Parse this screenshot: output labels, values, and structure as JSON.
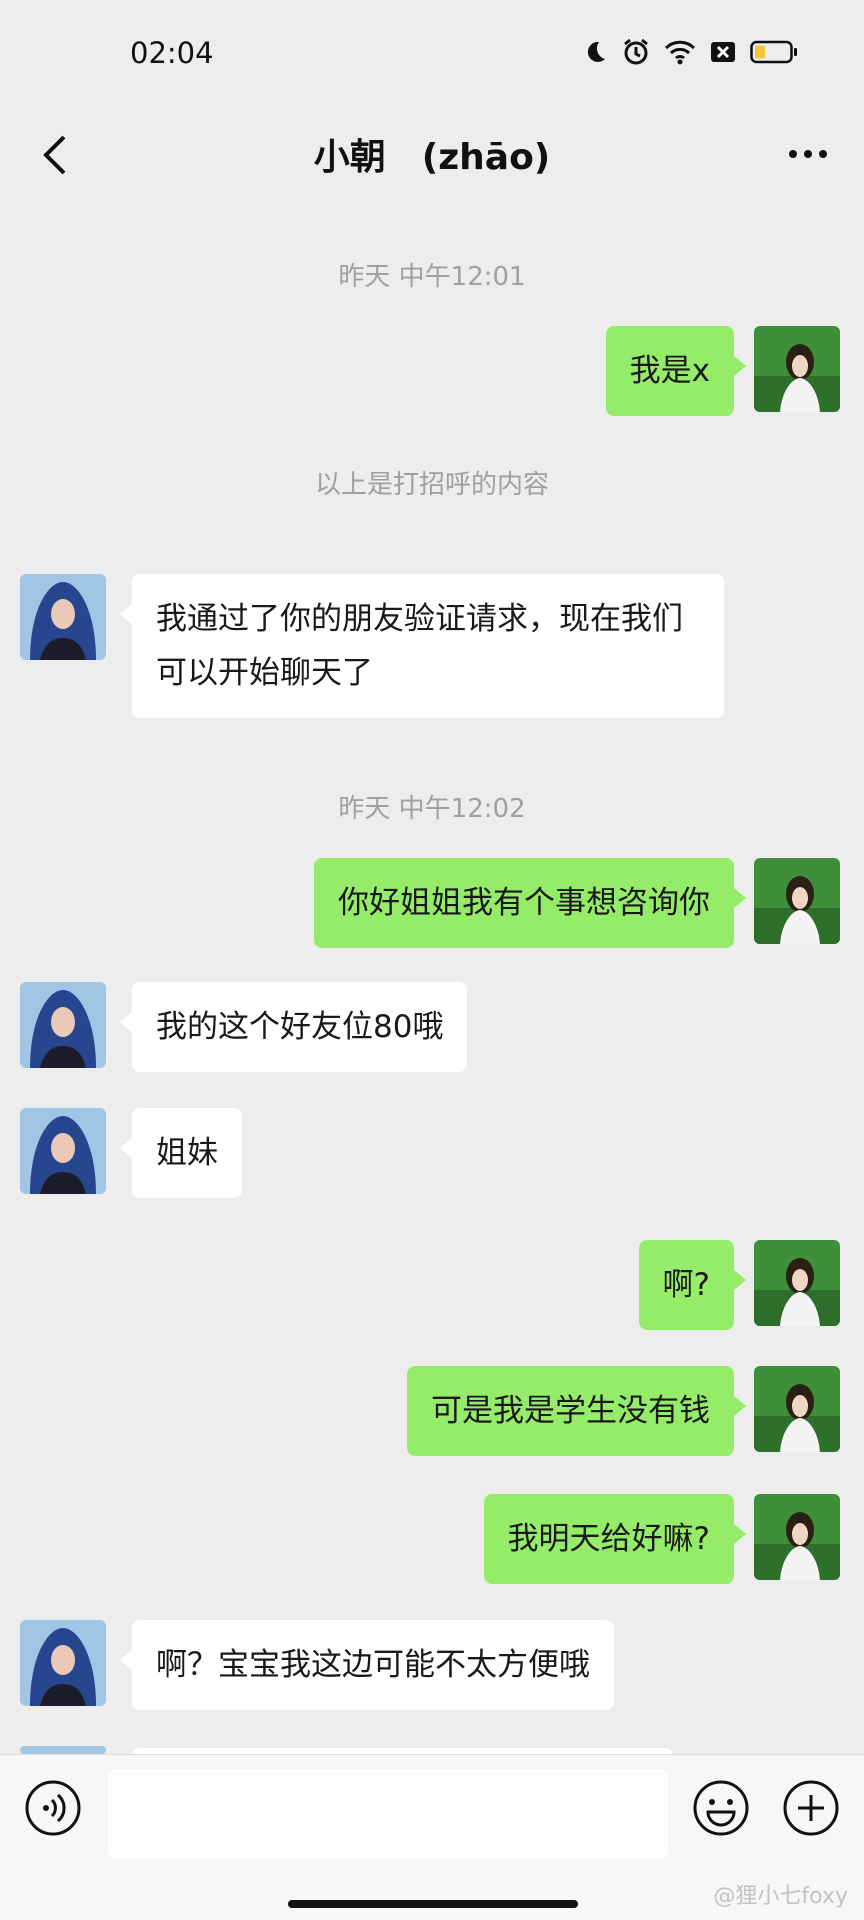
{
  "status_bar": {
    "time": "02:04",
    "icons": [
      "moon-icon",
      "alarm-icon",
      "wifi-icon",
      "no-sim-icon",
      "battery-icon"
    ],
    "battery_color": "#f5c542"
  },
  "nav": {
    "title": "小朝　(zhāo)",
    "back_icon": "chevron-left-icon",
    "more_icon": "more-icon"
  },
  "colors": {
    "background": "#ededed",
    "my_bubble": "#95ec69",
    "their_bubble": "#ffffff",
    "meta_text": "#a0a0a0"
  },
  "messages": [
    {
      "type": "timestamp",
      "text": "昨天 中午12:01"
    },
    {
      "type": "mine",
      "text": "我是x"
    },
    {
      "type": "system",
      "text": "以上是打招呼的内容"
    },
    {
      "type": "theirs",
      "text": "我通过了你的朋友验证请求，现在我们可以开始聊天了"
    },
    {
      "type": "timestamp",
      "text": "昨天 中午12:02"
    },
    {
      "type": "mine",
      "text": "你好姐姐我有个事想咨询你"
    },
    {
      "type": "theirs",
      "text": "我的这个好友位80哦"
    },
    {
      "type": "theirs",
      "text": "姐妹"
    },
    {
      "type": "mine",
      "text": "啊?"
    },
    {
      "type": "mine",
      "text": "可是我是学生没有钱"
    },
    {
      "type": "mine",
      "text": "我明天给好嘛?"
    },
    {
      "type": "theirs",
      "text": "啊？宝宝我这边可能不太方便哦"
    }
  ],
  "input_bar": {
    "voice_icon": "voice-icon",
    "emoji_icon": "emoji-icon",
    "plus_icon": "plus-icon",
    "placeholder": ""
  },
  "watermark": "@狸小七foxy"
}
